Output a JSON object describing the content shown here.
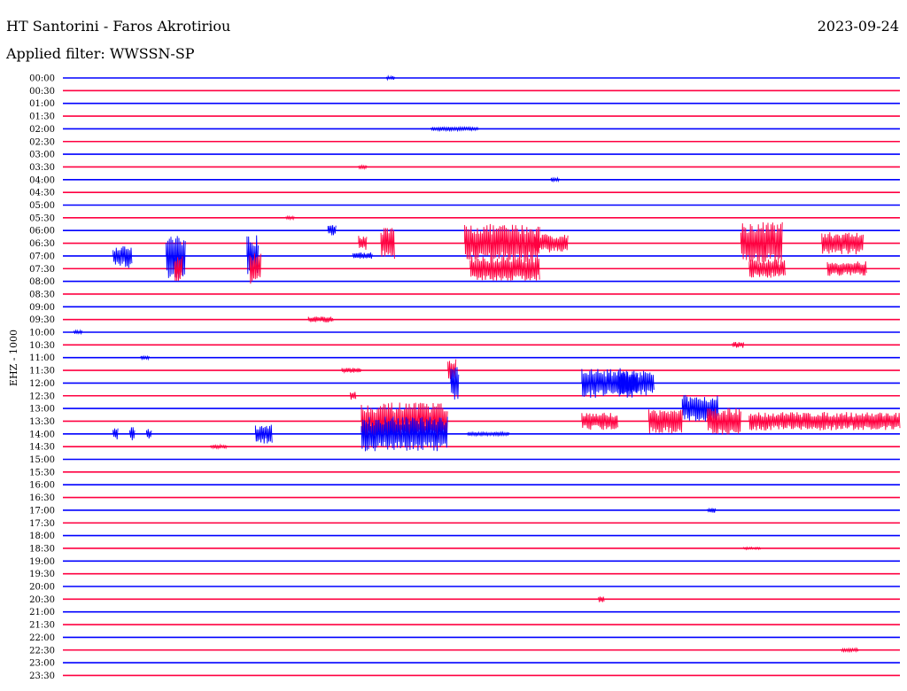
{
  "header": {
    "title": "HT Santorini - Faros Akrotiriou",
    "date": "2023-09-24",
    "filter": "Applied filter: WWSSN-SP"
  },
  "chart_data": {
    "type": "line",
    "title": "HT Santorini - Faros Akrotiriou",
    "date": "2023-09-24",
    "filter": "WWSSN-SP",
    "ylabel": "EHZ - 1000",
    "xlabel": "",
    "colors": {
      "even_trace": "#0000ff",
      "odd_trace": "#ff0040"
    },
    "row_labels": [
      "00:00",
      "00:30",
      "01:00",
      "01:30",
      "02:00",
      "02:30",
      "03:00",
      "03:30",
      "04:00",
      "04:30",
      "05:00",
      "05:30",
      "06:00",
      "06:30",
      "07:00",
      "07:30",
      "08:00",
      "08:30",
      "09:00",
      "09:30",
      "10:00",
      "10:30",
      "11:00",
      "11:30",
      "12:00",
      "12:30",
      "13:00",
      "13:30",
      "14:00",
      "14:30",
      "15:00",
      "15:30",
      "16:00",
      "16:30",
      "17:00",
      "17:30",
      "18:00",
      "18:30",
      "19:00",
      "19:30",
      "20:00",
      "20:30",
      "21:00",
      "21:30",
      "22:00",
      "22:30",
      "23:00",
      "23:30"
    ],
    "minutes_per_row": 30,
    "events": [
      {
        "row": "00:00",
        "start_min": 11.6,
        "duration_min": 0.3,
        "amplitude": 0.3
      },
      {
        "row": "02:00",
        "start_min": 13.2,
        "duration_min": 1.7,
        "amplitude": 0.3
      },
      {
        "row": "03:30",
        "start_min": 10.6,
        "duration_min": 0.3,
        "amplitude": 0.3
      },
      {
        "row": "04:00",
        "start_min": 17.5,
        "duration_min": 0.3,
        "amplitude": 0.3
      },
      {
        "row": "05:30",
        "start_min": 8.0,
        "duration_min": 0.3,
        "amplitude": 0.3
      },
      {
        "row": "06:00",
        "start_min": 9.5,
        "duration_min": 0.3,
        "amplitude": 0.9
      },
      {
        "row": "06:30",
        "start_min": 10.6,
        "duration_min": 0.3,
        "amplitude": 1.2
      },
      {
        "row": "06:30",
        "start_min": 11.4,
        "duration_min": 0.5,
        "amplitude": 2.6
      },
      {
        "row": "06:30",
        "start_min": 14.4,
        "duration_min": 2.7,
        "amplitude": 3.1
      },
      {
        "row": "06:30",
        "start_min": 16.9,
        "duration_min": 1.2,
        "amplitude": 1.5
      },
      {
        "row": "06:30",
        "start_min": 24.3,
        "duration_min": 1.5,
        "amplitude": 3.5
      },
      {
        "row": "06:30",
        "start_min": 27.2,
        "duration_min": 1.5,
        "amplitude": 1.8
      },
      {
        "row": "07:00",
        "start_min": 1.8,
        "duration_min": 0.3,
        "amplitude": 1.6
      },
      {
        "row": "07:00",
        "start_min": 2.1,
        "duration_min": 0.4,
        "amplitude": 2.0
      },
      {
        "row": "07:00",
        "start_min": 3.7,
        "duration_min": 0.7,
        "amplitude": 3.6
      },
      {
        "row": "07:00",
        "start_min": 6.6,
        "duration_min": 0.4,
        "amplitude": 3.4
      },
      {
        "row": "07:00",
        "start_min": 10.4,
        "duration_min": 0.7,
        "amplitude": 0.6
      },
      {
        "row": "07:30",
        "start_min": 4.0,
        "duration_min": 0.3,
        "amplitude": 2.0
      },
      {
        "row": "07:30",
        "start_min": 6.7,
        "duration_min": 0.4,
        "amplitude": 2.5
      },
      {
        "row": "07:30",
        "start_min": 14.6,
        "duration_min": 2.5,
        "amplitude": 2.0
      },
      {
        "row": "07:30",
        "start_min": 24.6,
        "duration_min": 1.3,
        "amplitude": 1.5
      },
      {
        "row": "07:30",
        "start_min": 27.4,
        "duration_min": 1.4,
        "amplitude": 1.2
      },
      {
        "row": "09:30",
        "start_min": 8.8,
        "duration_min": 0.9,
        "amplitude": 0.5
      },
      {
        "row": "10:00",
        "start_min": 0.4,
        "duration_min": 0.3,
        "amplitude": 0.3
      },
      {
        "row": "10:30",
        "start_min": 24.0,
        "duration_min": 0.4,
        "amplitude": 0.5
      },
      {
        "row": "11:00",
        "start_min": 2.8,
        "duration_min": 0.3,
        "amplitude": 0.3
      },
      {
        "row": "11:30",
        "start_min": 10.0,
        "duration_min": 0.7,
        "amplitude": 0.4
      },
      {
        "row": "11:30",
        "start_min": 13.8,
        "duration_min": 0.3,
        "amplitude": 1.8
      },
      {
        "row": "12:00",
        "start_min": 13.9,
        "duration_min": 0.3,
        "amplitude": 3.0
      },
      {
        "row": "12:00",
        "start_min": 18.6,
        "duration_min": 2.0,
        "amplitude": 2.4
      },
      {
        "row": "12:00",
        "start_min": 19.9,
        "duration_min": 1.3,
        "amplitude": 2.0
      },
      {
        "row": "12:30",
        "start_min": 10.3,
        "duration_min": 0.2,
        "amplitude": 0.7
      },
      {
        "row": "13:00",
        "start_min": 22.2,
        "duration_min": 1.3,
        "amplitude": 2.2
      },
      {
        "row": "13:30",
        "start_min": 10.7,
        "duration_min": 3.1,
        "amplitude": 3.0
      },
      {
        "row": "13:30",
        "start_min": 18.6,
        "duration_min": 1.3,
        "amplitude": 1.4
      },
      {
        "row": "13:30",
        "start_min": 21.0,
        "duration_min": 1.2,
        "amplitude": 2.0
      },
      {
        "row": "13:30",
        "start_min": 23.1,
        "duration_min": 1.2,
        "amplitude": 2.2
      },
      {
        "row": "13:30",
        "start_min": 24.6,
        "duration_min": 5.4,
        "amplitude": 1.5
      },
      {
        "row": "14:00",
        "start_min": 1.8,
        "duration_min": 0.2,
        "amplitude": 0.9
      },
      {
        "row": "14:00",
        "start_min": 2.4,
        "duration_min": 0.2,
        "amplitude": 1.1
      },
      {
        "row": "14:00",
        "start_min": 3.0,
        "duration_min": 0.2,
        "amplitude": 0.8
      },
      {
        "row": "14:00",
        "start_min": 6.9,
        "duration_min": 0.6,
        "amplitude": 1.6
      },
      {
        "row": "14:00",
        "start_min": 10.7,
        "duration_min": 3.1,
        "amplitude": 2.8
      },
      {
        "row": "14:00",
        "start_min": 14.5,
        "duration_min": 1.5,
        "amplitude": 0.3
      },
      {
        "row": "14:30",
        "start_min": 5.3,
        "duration_min": 0.6,
        "amplitude": 0.3
      },
      {
        "row": "17:00",
        "start_min": 23.1,
        "duration_min": 0.3,
        "amplitude": 0.4
      },
      {
        "row": "18:30",
        "start_min": 24.4,
        "duration_min": 0.6,
        "amplitude": 0.2
      },
      {
        "row": "20:30",
        "start_min": 19.2,
        "duration_min": 0.2,
        "amplitude": 0.5
      },
      {
        "row": "22:30",
        "start_min": 27.9,
        "duration_min": 0.6,
        "amplitude": 0.3
      }
    ]
  }
}
